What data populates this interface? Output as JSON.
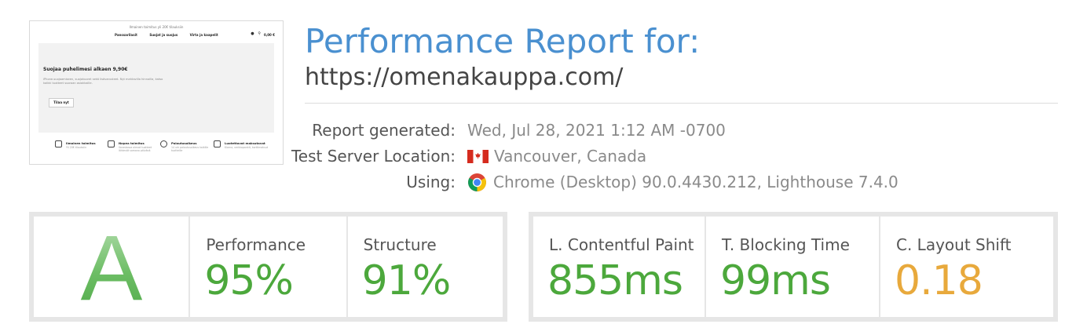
{
  "thumbnail": {
    "shipping_note": "Ilmainen toimitus yli 20€ tilauksiin",
    "nav": [
      "Panssarilasit",
      "Suojat ja suojus",
      "Virta ja kaapelit"
    ],
    "cart_total": "0,00 €",
    "hero_heading": "Suojaa puhelimesi alkaen 9,90€",
    "hero_text": "iPhone-suojaamiseen, suojakuoret sekä lisävarusteet. Nyt mahtavilla hinnoilla, katso kaikki tuotteet suoraan asiakkaille.",
    "hero_button": "Tilaa nyt",
    "features": [
      {
        "title": "Ilmainen toimitus",
        "sub": "Yli 20€ tilauksiin"
      },
      {
        "title": "Nopea toimitus",
        "sub": "Varastossa olevat tuotteet lähtevät samana päivänä"
      },
      {
        "title": "Palautusoikeus",
        "sub": "14 vrk palautusoikeus kaikille tuotteille"
      },
      {
        "title": "Luotettavat maksutavat",
        "sub": "Klarna, verkkopankit, korttimaksut"
      }
    ]
  },
  "report": {
    "title": "Performance Report for:",
    "url": "https://omenakauppa.com/",
    "generated_label": "Report generated:",
    "generated_value": "Wed, Jul 28, 2021 1:12 AM -0700",
    "location_label": "Test Server Location:",
    "location_value": "Vancouver, Canada",
    "using_label": "Using:",
    "using_value": "Chrome (Desktop) 90.0.4430.212, Lighthouse 7.4.0"
  },
  "grades": {
    "overall": "A",
    "performance_label": "Performance",
    "performance_value": "95%",
    "structure_label": "Structure",
    "structure_value": "91%"
  },
  "web_vitals": {
    "lcp_label": "L. Contentful Paint",
    "lcp_value": "855ms",
    "tbt_label": "T. Blocking Time",
    "tbt_value": "99ms",
    "cls_label": "C. Layout Shift",
    "cls_value": "0.18"
  },
  "colors": {
    "title_blue": "#4a90d0",
    "good_green": "#4ca83c",
    "warn_orange": "#e8a93c",
    "grade_green": "#55b05a"
  },
  "icons": [
    "canada-flag-icon",
    "chrome-icon"
  ]
}
